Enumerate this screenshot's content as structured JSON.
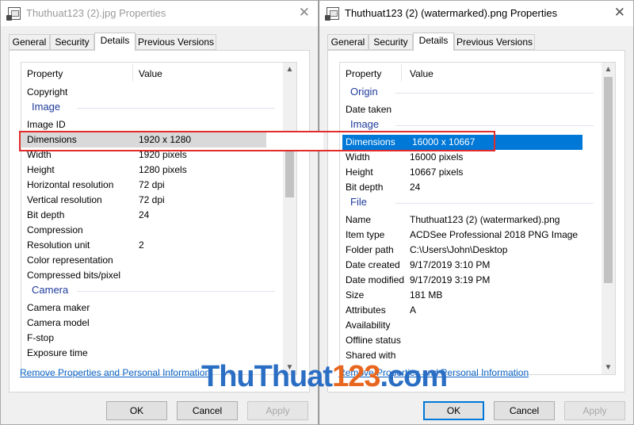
{
  "left_dialog": {
    "title": "Thuthuat123 (2).jpg Properties",
    "close": "✕",
    "tabs": [
      "General",
      "Security",
      "Details",
      "Previous Versions"
    ],
    "active_tab": "Details",
    "columns": {
      "property": "Property",
      "value": "Value"
    },
    "rows": [
      {
        "type": "item",
        "k": "Copyright",
        "v": ""
      },
      {
        "type": "group",
        "label": "Image"
      },
      {
        "type": "item",
        "k": "Image ID",
        "v": ""
      },
      {
        "type": "item",
        "k": "Dimensions",
        "v": "1920 x 1280",
        "selected": true
      },
      {
        "type": "item",
        "k": "Width",
        "v": "1920 pixels"
      },
      {
        "type": "item",
        "k": "Height",
        "v": "1280 pixels"
      },
      {
        "type": "item",
        "k": "Horizontal resolution",
        "v": "72 dpi"
      },
      {
        "type": "item",
        "k": "Vertical resolution",
        "v": "72 dpi"
      },
      {
        "type": "item",
        "k": "Bit depth",
        "v": "24"
      },
      {
        "type": "item",
        "k": "Compression",
        "v": ""
      },
      {
        "type": "item",
        "k": "Resolution unit",
        "v": "2"
      },
      {
        "type": "item",
        "k": "Color representation",
        "v": ""
      },
      {
        "type": "item",
        "k": "Compressed bits/pixel",
        "v": ""
      },
      {
        "type": "group",
        "label": "Camera"
      },
      {
        "type": "item",
        "k": "Camera maker",
        "v": ""
      },
      {
        "type": "item",
        "k": "Camera model",
        "v": ""
      },
      {
        "type": "item",
        "k": "F-stop",
        "v": ""
      },
      {
        "type": "item",
        "k": "Exposure time",
        "v": ""
      }
    ],
    "link": "Remove Properties and Personal Information",
    "buttons": {
      "ok": "OK",
      "cancel": "Cancel",
      "apply": "Apply"
    }
  },
  "right_dialog": {
    "title": "Thuthuat123 (2) (watermarked).png Properties",
    "close": "✕",
    "tabs": [
      "General",
      "Security",
      "Details",
      "Previous Versions"
    ],
    "active_tab": "Details",
    "columns": {
      "property": "Property",
      "value": "Value"
    },
    "rows": [
      {
        "type": "group",
        "label": "Origin"
      },
      {
        "type": "item",
        "k": "Date taken",
        "v": ""
      },
      {
        "type": "group",
        "label": "Image"
      },
      {
        "type": "item",
        "k": "Dimensions",
        "v": "16000 x 10667",
        "selected": true
      },
      {
        "type": "item",
        "k": "Width",
        "v": "16000 pixels"
      },
      {
        "type": "item",
        "k": "Height",
        "v": "10667 pixels"
      },
      {
        "type": "item",
        "k": "Bit depth",
        "v": "24"
      },
      {
        "type": "group",
        "label": "File"
      },
      {
        "type": "item",
        "k": "Name",
        "v": "Thuthuat123 (2) (watermarked).png"
      },
      {
        "type": "item",
        "k": "Item type",
        "v": "ACDSee Professional 2018 PNG Image"
      },
      {
        "type": "item",
        "k": "Folder path",
        "v": "C:\\Users\\John\\Desktop"
      },
      {
        "type": "item",
        "k": "Date created",
        "v": "9/17/2019 3:10 PM"
      },
      {
        "type": "item",
        "k": "Date modified",
        "v": "9/17/2019 3:19 PM"
      },
      {
        "type": "item",
        "k": "Size",
        "v": "181 MB"
      },
      {
        "type": "item",
        "k": "Attributes",
        "v": "A"
      },
      {
        "type": "item",
        "k": "Availability",
        "v": ""
      },
      {
        "type": "item",
        "k": "Offline status",
        "v": ""
      },
      {
        "type": "item",
        "k": "Shared with",
        "v": ""
      }
    ],
    "link": "Remove Properties and Personal Information",
    "buttons": {
      "ok": "OK",
      "cancel": "Cancel",
      "apply": "Apply"
    }
  },
  "watermark": {
    "part1": "ThuThuat",
    "part2": "123",
    "part3": ".com"
  },
  "colors": {
    "highlight_box": "#e22b2b",
    "selection": "#0078d7",
    "group_header": "#1e3a9a",
    "link": "#0b63c5"
  },
  "icons": {
    "title": "file-properties-icon",
    "close": "close-icon",
    "scroll_up": "chevron-up-icon",
    "scroll_down": "chevron-down-icon"
  }
}
